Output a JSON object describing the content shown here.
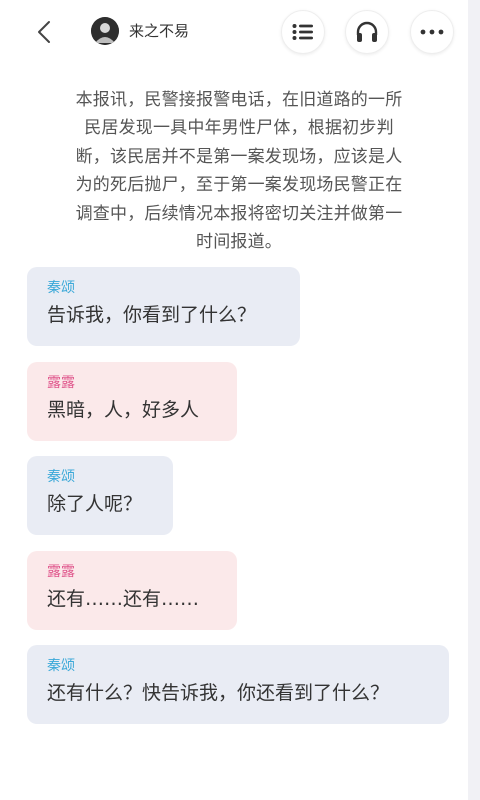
{
  "header": {
    "author": "来之不易",
    "icons": [
      "back-icon",
      "avatar",
      "list-icon",
      "headphones-icon",
      "more-icon"
    ]
  },
  "narration": "本报讯，民警接报警电话，在旧道路的一所民居发现一具中年男性尸体，根据初步判断，该民居并不是第一案发现场，应该是人为的死后抛尸，至于第一案发现场民警正在调查中，后续情况本报将密切关注并做第一时间报道。",
  "messages": [
    {
      "speaker": "秦颂",
      "text": "告诉我，你看到了什么？"
    },
    {
      "speaker": "露露",
      "text": "黑暗，人，好多人"
    },
    {
      "speaker": "秦颂",
      "text": "除了人呢？"
    },
    {
      "speaker": "露露",
      "text": "还有……还有……"
    },
    {
      "speaker": "秦颂",
      "text": "还有什么？快告诉我，你还看到了什么？"
    }
  ],
  "colors": {
    "speaker_qin": "#3aa8d8",
    "speaker_lu": "#e0568c",
    "bubble_qin": "#e9ecf4",
    "bubble_lu": "#fbe9ea"
  }
}
